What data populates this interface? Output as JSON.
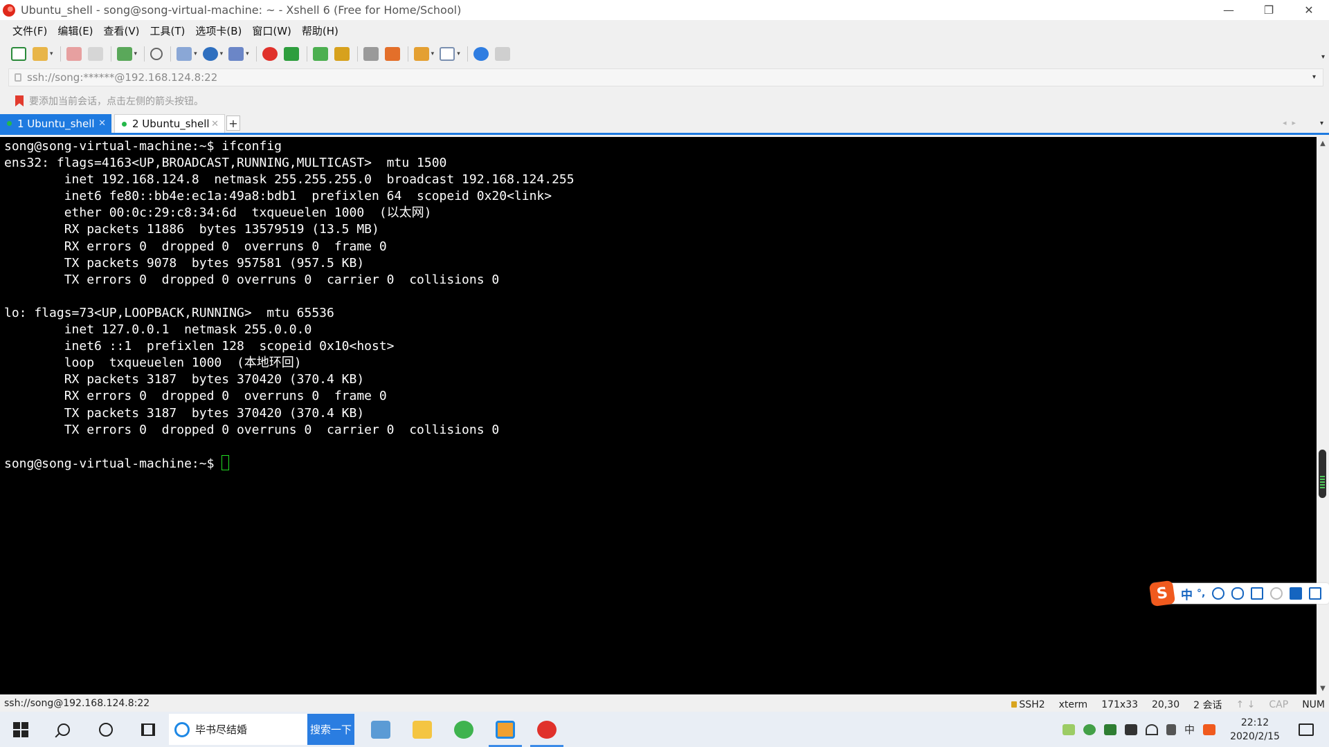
{
  "window": {
    "title": "Ubuntu_shell - song@song-virtual-machine: ~ - Xshell 6 (Free for Home/School)",
    "controls": [
      "—",
      "❐",
      "✕"
    ]
  },
  "menu": [
    "文件(F)",
    "编辑(E)",
    "查看(V)",
    "工具(T)",
    "选项卡(B)",
    "窗口(W)",
    "帮助(H)"
  ],
  "address": {
    "value": "ssh://song:******@192.168.124.8:22"
  },
  "hint": "要添加当前会话，点击左侧的箭头按钮。",
  "tabs": [
    {
      "label": "1 Ubuntu_shell",
      "close": "✕"
    },
    {
      "label": "2 Ubuntu_shell",
      "close": "✕"
    }
  ],
  "tab_add": "+",
  "terminal": {
    "lines": [
      "song@song-virtual-machine:~$ ifconfig",
      "ens32: flags=4163<UP,BROADCAST,RUNNING,MULTICAST>  mtu 1500",
      "        inet 192.168.124.8  netmask 255.255.255.0  broadcast 192.168.124.255",
      "        inet6 fe80::bb4e:ec1a:49a8:bdb1  prefixlen 64  scopeid 0x20<link>",
      "        ether 00:0c:29:c8:34:6d  txqueuelen 1000  (以太网)",
      "        RX packets 11886  bytes 13579519 (13.5 MB)",
      "        RX errors 0  dropped 0  overruns 0  frame 0",
      "        TX packets 9078  bytes 957581 (957.5 KB)",
      "        TX errors 0  dropped 0 overruns 0  carrier 0  collisions 0",
      "",
      "lo: flags=73<UP,LOOPBACK,RUNNING>  mtu 65536",
      "        inet 127.0.0.1  netmask 255.0.0.0",
      "        inet6 ::1  prefixlen 128  scopeid 0x10<host>",
      "        loop  txqueuelen 1000  (本地环回)",
      "        RX packets 3187  bytes 370420 (370.4 KB)",
      "        RX errors 0  dropped 0  overruns 0  frame 0",
      "        TX packets 3187  bytes 370420 (370.4 KB)",
      "        TX errors 0  dropped 0 overruns 0  carrier 0  collisions 0",
      ""
    ],
    "prompt": "song@song-virtual-machine:~$ "
  },
  "ime": {
    "logo": "S",
    "lang": "中",
    "punct": "°,"
  },
  "status": {
    "connection": "ssh://song@192.168.124.8:22",
    "protocol": "SSH2",
    "term": "xterm",
    "size": "171x33",
    "cursor": "20,30",
    "sessions": "2 会话",
    "cap": "CAP",
    "num": "NUM"
  },
  "taskbar": {
    "search_text": "毕书尽结婚",
    "search_button": "搜索一下",
    "tray_ime": "中",
    "time": "22:12",
    "date": "2020/2/15"
  },
  "colors": {
    "accent": "#1e7ae0",
    "terminal_bg": "#000000",
    "cursor": "#22dd22"
  }
}
